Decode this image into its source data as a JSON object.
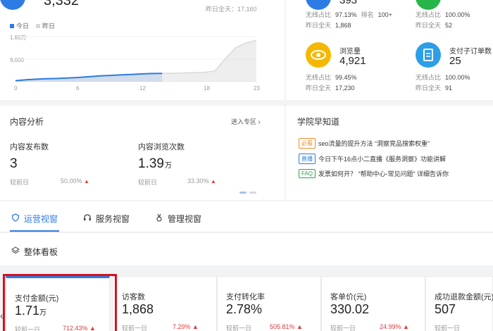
{
  "top_chart": {
    "current_value": "3,332",
    "yesterday_total": "昨日全天：17,160",
    "legend": [
      {
        "label": "今日",
        "color": "#2d7be5"
      },
      {
        "label": "昨日",
        "color": "#d9d9d9"
      }
    ],
    "y_ticks": [
      "1.80万",
      "9,000",
      "0"
    ],
    "x_ticks": [
      "0",
      "6",
      "12",
      "18",
      "23"
    ]
  },
  "chart_data": {
    "type": "area",
    "x_ticks": [
      0,
      6,
      12,
      18,
      23
    ],
    "y_ticks": [
      "1.80万",
      "9,000",
      "0"
    ],
    "ylim": [
      0,
      18000
    ],
    "series": [
      {
        "name": "今日",
        "color": "#2d7be5",
        "x": [
          0,
          1,
          2,
          3,
          4,
          5,
          6,
          7,
          8,
          9,
          10,
          11,
          12,
          13,
          14
        ],
        "values": [
          400,
          800,
          1000,
          1200,
          1300,
          1500,
          1700,
          2000,
          2300,
          2500,
          2700,
          2900,
          3100,
          3250,
          3332
        ]
      },
      {
        "name": "昨日",
        "color": "#d9d9d9",
        "x": [
          0,
          2,
          4,
          6,
          8,
          10,
          12,
          14,
          16,
          18,
          19,
          20,
          21,
          22,
          23
        ],
        "values": [
          400,
          900,
          1300,
          1700,
          2200,
          2600,
          3000,
          3300,
          3500,
          3700,
          4200,
          9000,
          13500,
          15500,
          16500
        ]
      }
    ]
  },
  "right_metrics": {
    "top_left": {
      "value": "393",
      "row1_label": "无线占比",
      "row1_value": "97.13%",
      "row1_extra_label": "排名",
      "row1_extra_value": "100+",
      "row2_label": "昨日全天",
      "row2_value": "1,868"
    },
    "top_right": {
      "row1_label": "无线占比",
      "row1_value": "100.00%",
      "row2_label": "昨日全天",
      "row2_value": "52"
    },
    "browse": {
      "title": "浏览量",
      "value": "4,921",
      "row1_label": "无线占比",
      "row1_value": "99.45%",
      "row2_label": "昨日全天",
      "row2_value": "17,230"
    },
    "orders": {
      "title": "支付子订单数",
      "value": "25",
      "row1_label": "无线占比",
      "row1_value": "100.00%",
      "row2_label": "昨日全天",
      "row2_value": "91"
    }
  },
  "content_analysis": {
    "title": "内容分析",
    "enter_link": "进入专区",
    "items": [
      {
        "label": "内容发布数",
        "value": "3",
        "unit": "",
        "foot": "较前日",
        "pct": "50.00%"
      },
      {
        "label": "内容浏览次数",
        "value": "1.39",
        "unit": "万",
        "foot": "较前日",
        "pct": "33.30%"
      }
    ]
  },
  "news": {
    "title": "学院早知道",
    "items": [
      {
        "tag": "必看",
        "tag_color": "#f08a24",
        "text": "seo流量的提升方法 “洞察竞品搜索权重”"
      },
      {
        "tag": "直播",
        "tag_color": "#2d7be5",
        "text": "今日下午16点小二直播《服务洞察》功能讲解"
      },
      {
        "tag": "FAQ",
        "tag_color": "#27a844",
        "text": "发票如何开？ “帮助中心-常见问题” 详细告诉你"
      }
    ]
  },
  "tabs": [
    {
      "label": "运营视窗",
      "active": true
    },
    {
      "label": "服务视窗",
      "active": false
    },
    {
      "label": "管理视窗",
      "active": false
    }
  ],
  "board": {
    "title": "整体看板",
    "stats": [
      {
        "label": "支付金额(元)",
        "value": "1.71",
        "unit": "万",
        "foot": "较前一日",
        "pct": "712.43%"
      },
      {
        "label": "访客数",
        "value": "1,868",
        "unit": "",
        "foot": "较前一日",
        "pct": "7.29%"
      },
      {
        "label": "支付转化率",
        "value": "2.78%",
        "unit": "",
        "foot": "较前一日",
        "pct": "505.81%"
      },
      {
        "label": "客单价(元)",
        "value": "330.02",
        "unit": "",
        "foot": "较前一日",
        "pct": "24.99%"
      },
      {
        "label": "成功退款金额(元)",
        "value": "507",
        "unit": "",
        "foot": "较前一日",
        "pct": ""
      }
    ]
  }
}
